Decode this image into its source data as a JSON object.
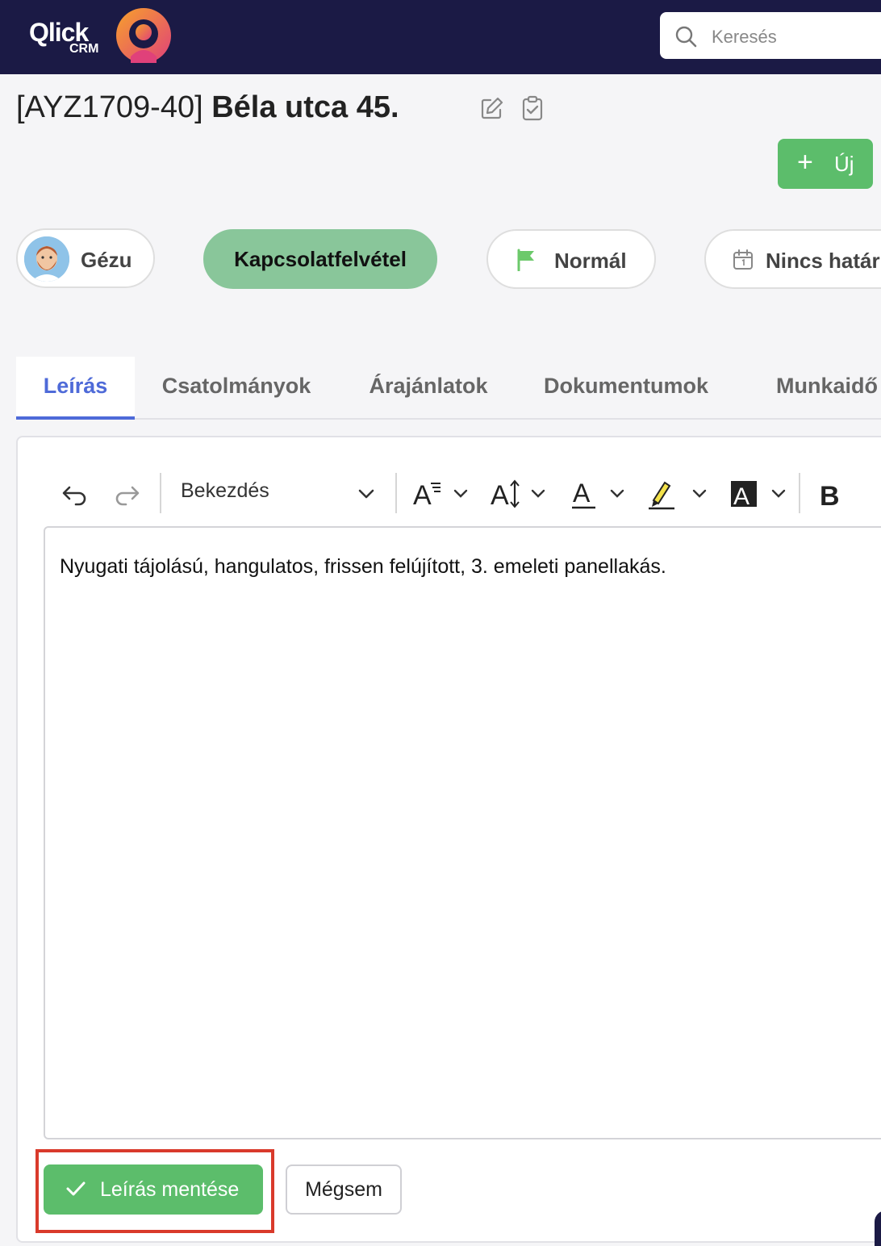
{
  "brand": {
    "name": "Qlick",
    "sub": "CRM"
  },
  "search": {
    "placeholder": "Keresés"
  },
  "page": {
    "code": "[AYZ1709-40]",
    "title": "Béla utca 45."
  },
  "actions": {
    "new_label": "Új"
  },
  "pills": {
    "assignee": "Gézu",
    "status": "Kapcsolatfelvétel",
    "priority": "Normál",
    "deadline": "Nincs határ"
  },
  "tabs": [
    {
      "label": "Leírás"
    },
    {
      "label": "Csatolmányok"
    },
    {
      "label": "Árajánlatok"
    },
    {
      "label": "Dokumentumok"
    },
    {
      "label": "Munkaidő"
    }
  ],
  "editor": {
    "block_format": "Bekezdés",
    "bold_label": "B",
    "content": "Nyugati tájolású, hangulatos, frissen felújított, 3. emeleti panellakás."
  },
  "buttons": {
    "save": "Leírás mentése",
    "cancel": "Mégsem"
  },
  "colors": {
    "topbar": "#1b1a45",
    "accent_green": "#5cbd6b",
    "status_green": "#89c69a",
    "tab_active": "#4e6ad8",
    "highlight": "#d93a2b"
  }
}
